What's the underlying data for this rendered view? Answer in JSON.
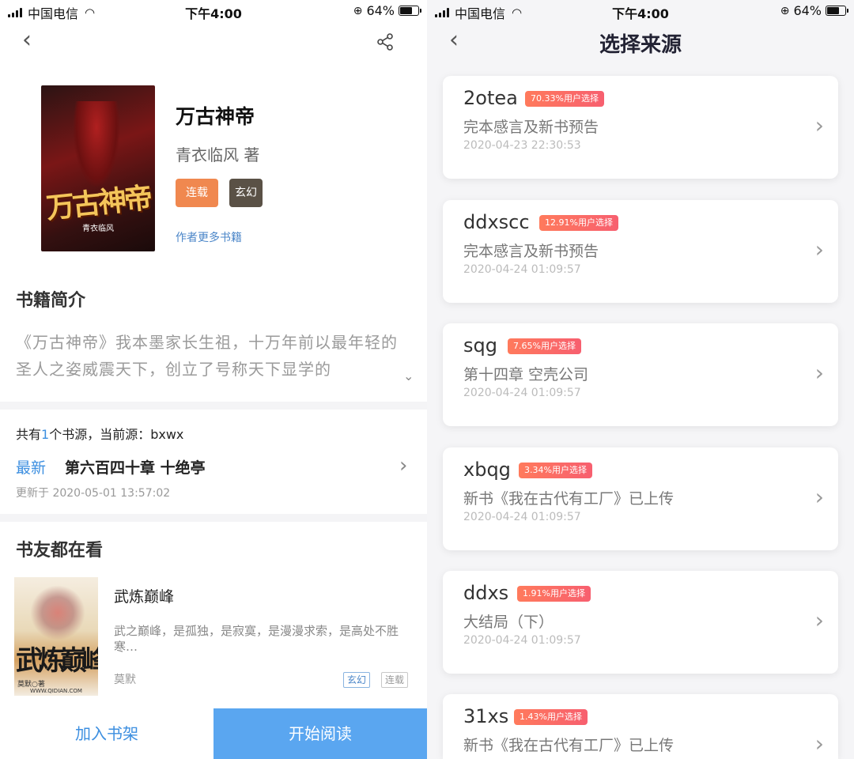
{
  "status": {
    "carrier": "中国电信",
    "time": "下午4:00",
    "battery": "64%",
    "icons": [
      "signal-icon",
      "wifi-icon",
      "orientation-lock-icon",
      "battery-icon"
    ]
  },
  "detail": {
    "book": {
      "title": "万古神帝",
      "author": "青衣临风 著",
      "tags": [
        "连载",
        "玄幻"
      ],
      "more_link": "作者更多书籍",
      "cover_title": "万古神帝",
      "cover_author": "青衣临风"
    },
    "intro_title": "书籍简介",
    "intro": "《万古神帝》我本墨家长生祖，十万年前以最年轻的圣人之姿威震天下，创立了号称天下显学的",
    "sources": {
      "prefix": "共有",
      "count": "1",
      "middle": "个书源，当前源：",
      "current": "bxwx"
    },
    "latest": {
      "label": "最新",
      "chapter": "第六百四十章 十绝亭",
      "updated": "更新于 2020-05-01 13:57:02"
    },
    "friends_title": "书友都在看",
    "recommend": {
      "title": "武炼巅峰",
      "desc": "武之巅峰，是孤独，是寂寞，是漫漫求索，是高处不胜寒…",
      "author": "莫默",
      "tags": [
        "玄幻",
        "连载"
      ],
      "cover_title": "武炼巅峰",
      "cover_author": "莫默○著",
      "cover_site": "WWW.QIDIAN.COM"
    },
    "buttons": {
      "shelf": "加入书架",
      "read": "开始阅读"
    }
  },
  "sources_page": {
    "title": "选择来源",
    "items": [
      {
        "name": "2otea",
        "badge": "70.33%用户选择",
        "chapter": "完本感言及新书预告",
        "date": "2020-04-23 22:30:53"
      },
      {
        "name": "ddxscc",
        "badge": "12.91%用户选择",
        "chapter": "完本感言及新书预告",
        "date": "2020-04-24 01:09:57"
      },
      {
        "name": "sqg",
        "badge": "7.65%用户选择",
        "chapter": "第十四章 空壳公司",
        "date": "2020-04-24 01:09:57"
      },
      {
        "name": "xbqg",
        "badge": "3.34%用户选择",
        "chapter": "新书《我在古代有工厂》已上传",
        "date": "2020-04-24 01:09:57"
      },
      {
        "name": "ddxs",
        "badge": "1.91%用户选择",
        "chapter": "大结局（下）",
        "date": "2020-04-24 01:09:57"
      },
      {
        "name": "31xs",
        "badge": "1.43%用户选择",
        "chapter": "新书《我在古代有工厂》已上传",
        "date": ""
      }
    ]
  }
}
